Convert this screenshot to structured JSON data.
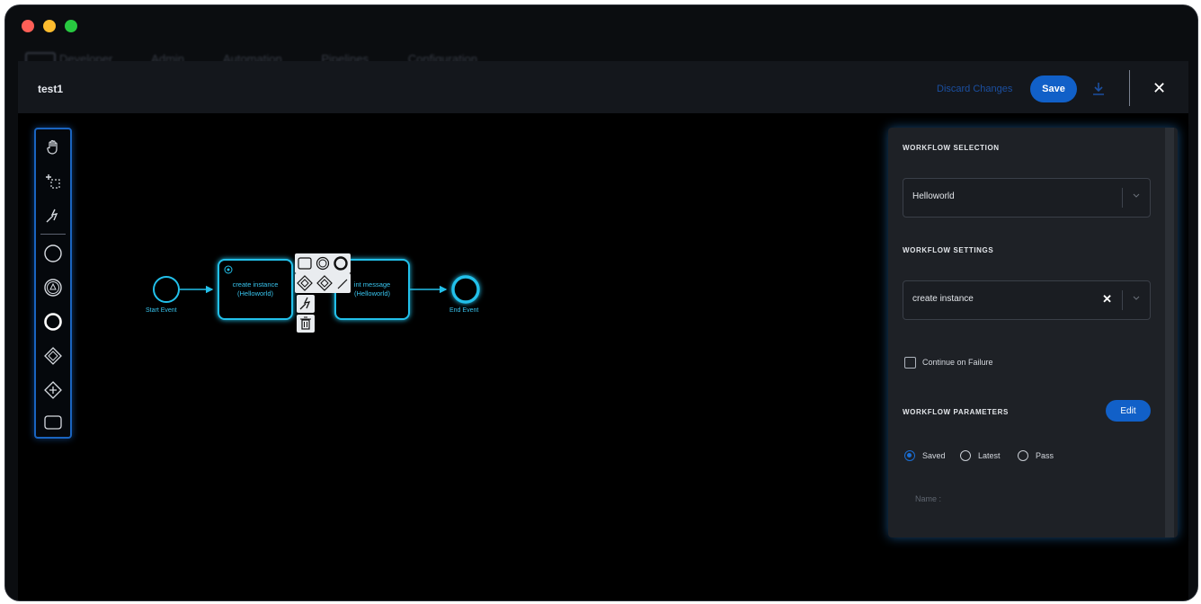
{
  "window": {
    "background_nav": [
      "Developer",
      "Admin",
      "Automation",
      "Pipelines",
      "Configuration"
    ]
  },
  "header": {
    "title": "test1",
    "discard_label": "Discard Changes",
    "save_label": "Save"
  },
  "palette": {
    "tools": [
      "hand-tool",
      "lasso-tool",
      "space-tool",
      "global-connect-tool",
      "start-event",
      "intermediate-event",
      "end-event",
      "exclusive-gateway",
      "parallel-gateway",
      "task"
    ]
  },
  "diagram": {
    "start_event_label": "Start Event",
    "end_event_label": "End Event",
    "task1_label": "create instance\n(Helloworld)",
    "task2_label": "int message\n(Helloworld)"
  },
  "panel": {
    "workflow_selection_title": "WORKFLOW SELECTION",
    "workflow_selection_value": "Helloworld",
    "workflow_settings_title": "WORKFLOW SETTINGS",
    "workflow_settings_value": "create instance",
    "continue_on_failure_label": "Continue on Failure",
    "continue_on_failure_checked": false,
    "workflow_parameters_title": "WORKFLOW PARAMETERS",
    "edit_label": "Edit",
    "radio_options": [
      "Saved",
      "Latest",
      "Pass"
    ],
    "radio_selected": "Saved",
    "name_placeholder": "Name :"
  },
  "colors": {
    "accent": "#1160c8",
    "diagram_stroke": "#22c0ea",
    "panel_bg": "#1e2126",
    "canvas_bg": "#000000"
  }
}
